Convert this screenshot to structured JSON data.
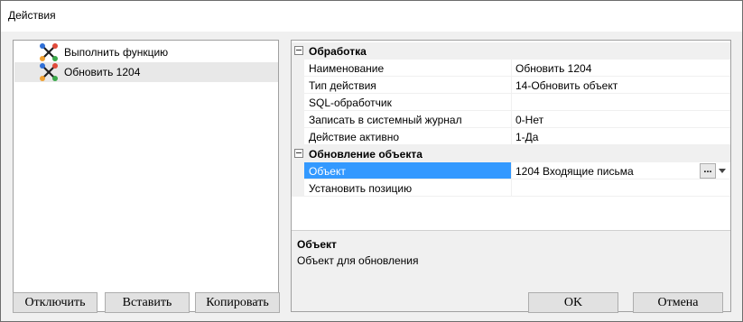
{
  "window": {
    "title": "Действия"
  },
  "tree": {
    "items": [
      {
        "label": "Выполнить функцию",
        "selected": false
      },
      {
        "label": "Обновить 1204",
        "selected": true
      }
    ]
  },
  "properties": {
    "categories": [
      {
        "label": "Обработка",
        "rows": [
          {
            "name": "Наименование",
            "value": "Обновить 1204"
          },
          {
            "name": "Тип действия",
            "value": "14-Обновить объект"
          },
          {
            "name": "SQL-обработчик",
            "value": ""
          },
          {
            "name": "Записать в системный журнал",
            "value": "0-Нет"
          },
          {
            "name": "Действие активно",
            "value": "1-Да"
          }
        ]
      },
      {
        "label": "Обновление объекта",
        "rows": [
          {
            "name": "Объект",
            "value": "1204 Входящие письма",
            "selected": true,
            "ellipsis": "..."
          },
          {
            "name": "Установить позицию",
            "value": ""
          }
        ]
      }
    ],
    "help": {
      "title": "Объект",
      "description": "Объект для обновления"
    }
  },
  "buttons": {
    "disable": "Отключить",
    "paste": "Вставить",
    "copy": "Копировать",
    "ok": "OK",
    "cancel": "Отмена"
  },
  "colors": {
    "selection": "#3399ff",
    "icon_blue": "#2f6fd6",
    "icon_red": "#e04a3a",
    "icon_orange": "#f0a030",
    "icon_green": "#3aa84a"
  }
}
